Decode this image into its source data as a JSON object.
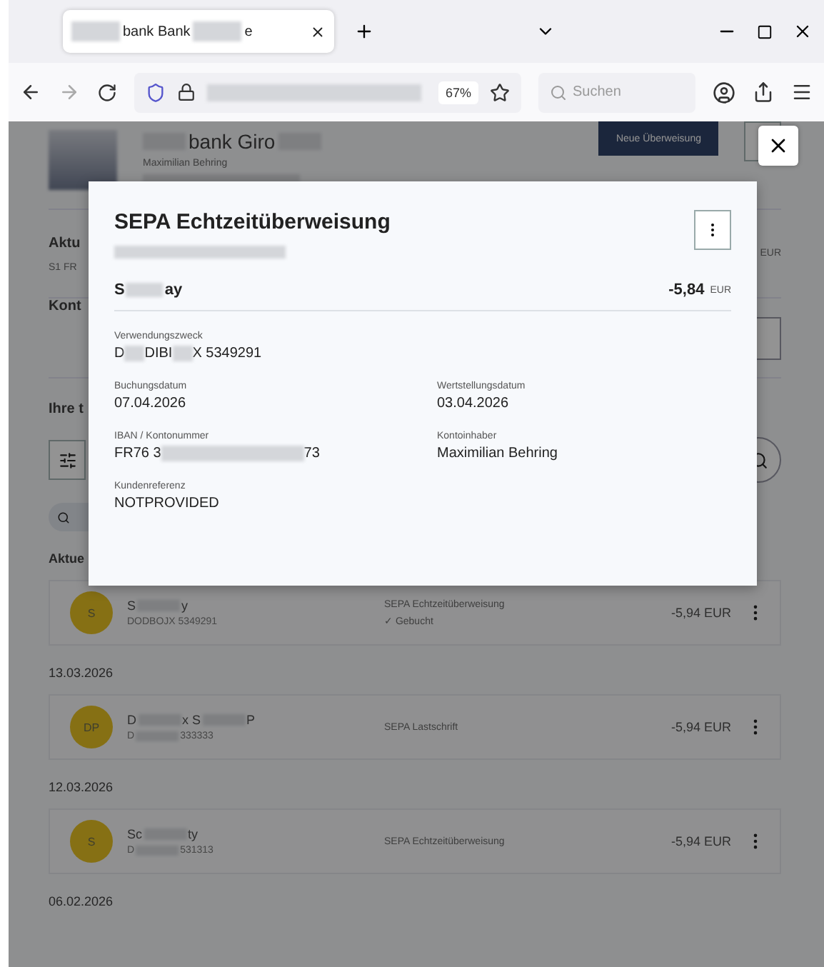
{
  "browser": {
    "tab_title": [
      {
        "kind": "redaction"
      },
      {
        "kind": "text",
        "text": "bank Bank"
      },
      {
        "kind": "redaction"
      },
      {
        "kind": "text",
        "text": "e"
      }
    ],
    "zoom": "67%",
    "search": {
      "placeholder": "Suchen"
    }
  },
  "page": {
    "account_title": [
      {
        "kind": "redaction"
      },
      {
        "kind": "text",
        "text": "bank Giro"
      },
      {
        "kind": "redaction"
      }
    ],
    "account_owner": "Maximilian Behring",
    "new_transfer_button": "Neue Überweisung",
    "balance_label": "Aktu",
    "balance_sub": "S1 FR",
    "balance_currency": "EUR",
    "contacts_label": "Kont",
    "transactions_label": "Ihre t",
    "groups": [
      {
        "heading": "Aktue",
        "rows": [
          {
            "initials": "S",
            "name": [
              {
                "kind": "text",
                "text": "S"
              },
              {
                "kind": "redaction"
              },
              {
                "kind": "text",
                "text": "y"
              }
            ],
            "reference": [
              {
                "kind": "text",
                "text": "DODBOJX 5349291"
              }
            ],
            "type": "SEPA Echtzeitüberweisung",
            "status": "✓ Gebucht",
            "amount": "-5,94 EUR"
          }
        ]
      },
      {
        "heading": "13.03.2026",
        "rows": [
          {
            "initials": "DP",
            "name": [
              {
                "kind": "text",
                "text": "D"
              },
              {
                "kind": "redaction"
              },
              {
                "kind": "text",
                "text": "x S"
              },
              {
                "kind": "redaction"
              },
              {
                "kind": "text",
                "text": "P"
              }
            ],
            "reference": [
              {
                "kind": "text",
                "text": "D"
              },
              {
                "kind": "redaction"
              },
              {
                "kind": "text",
                "text": "333333"
              }
            ],
            "type": "SEPA Lastschrift",
            "amount": "-5,94 EUR"
          }
        ]
      },
      {
        "heading": "12.03.2026",
        "rows": [
          {
            "initials": "S",
            "name": [
              {
                "kind": "text",
                "text": "Sc"
              },
              {
                "kind": "redaction"
              },
              {
                "kind": "text",
                "text": "ty"
              }
            ],
            "reference": [
              {
                "kind": "text",
                "text": "D"
              },
              {
                "kind": "redaction"
              },
              {
                "kind": "text",
                "text": "531313"
              }
            ],
            "type": "SEPA Echtzeitüberweisung",
            "amount": "-5,94 EUR"
          }
        ]
      },
      {
        "heading": "06.02.2026"
      }
    ]
  },
  "modal": {
    "title": "SEPA Echtzeitüberweisung",
    "payee": [
      {
        "kind": "text",
        "text": "S"
      },
      {
        "kind": "redaction"
      },
      {
        "kind": "text",
        "text": "ay"
      }
    ],
    "amount": "-5,84",
    "currency": "EUR",
    "rows": [
      [
        {
          "label": "Verwendungszweck",
          "value": [
            {
              "kind": "text",
              "text": "D"
            },
            {
              "kind": "redaction"
            },
            {
              "kind": "text",
              "text": "DIBI"
            },
            {
              "kind": "redaction"
            },
            {
              "kind": "text",
              "text": "X 5349291"
            }
          ]
        }
      ],
      [
        {
          "label": "Buchungsdatum",
          "value": [
            {
              "kind": "text",
              "text": "07.04.2026"
            }
          ]
        },
        {
          "label": "Wertstellungsdatum",
          "value": [
            {
              "kind": "text",
              "text": "03.04.2026"
            }
          ]
        }
      ],
      [
        {
          "label": "IBAN / Kontonummer",
          "value": [
            {
              "kind": "text",
              "text": "FR76 3"
            },
            {
              "kind": "redaction"
            },
            {
              "kind": "text",
              "text": "73"
            }
          ]
        },
        {
          "label": "Kontoinhaber",
          "value": [
            {
              "kind": "text",
              "text": "Maximilian Behring"
            }
          ]
        }
      ],
      [
        {
          "label": "Kundenreferenz",
          "value": [
            {
              "kind": "text",
              "text": "NOTPROVIDED"
            }
          ]
        }
      ]
    ]
  }
}
